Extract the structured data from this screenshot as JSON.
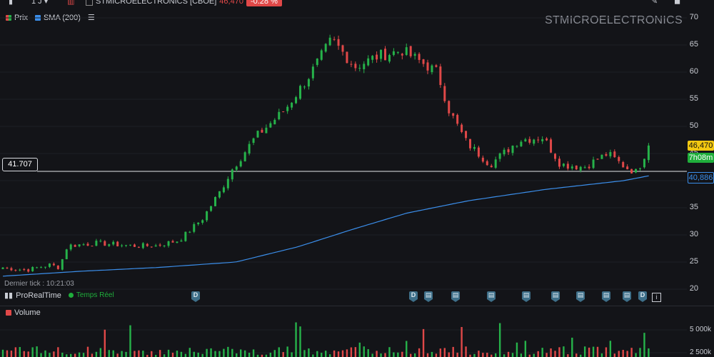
{
  "toolbar": {
    "interval": "1 J",
    "symbol_label": "STMICROELECTRONICS [CBOE]",
    "last_price": "46,470",
    "change": "-0.28 %"
  },
  "legend": {
    "price_label": "Prix",
    "sma_label": "SMA (200)",
    "price_color": "#26a69a",
    "sma_color": "#3b8eea"
  },
  "watermark": "STMICROELECTRONICS",
  "horizontal_line": {
    "label": "41.707"
  },
  "price_tags": {
    "last": "46,470",
    "countdown": "7h08m",
    "sma": "40,886"
  },
  "status": {
    "last_tick": "Dernier tick : 10:21:03",
    "provider": "ProRealTime",
    "mode": "Temps Réel"
  },
  "event_markers": [
    {
      "icon": "dividend-icon",
      "text": "D"
    },
    {
      "icon": "dividend-icon",
      "text": "D"
    },
    {
      "icon": "report-icon",
      "text": ""
    },
    {
      "icon": "report-icon",
      "text": ""
    },
    {
      "icon": "report-icon",
      "text": ""
    },
    {
      "icon": "report-icon",
      "text": ""
    },
    {
      "icon": "report-icon",
      "text": ""
    },
    {
      "icon": "report-icon",
      "text": ""
    },
    {
      "icon": "report-icon",
      "text": ""
    },
    {
      "icon": "dividend-icon",
      "text": "D"
    }
  ],
  "volume": {
    "label": "Volume",
    "yticks": [
      "5 000k",
      "2 500k"
    ]
  },
  "colors": {
    "up": "#26b24a",
    "down": "#e04848",
    "background": "#131418"
  },
  "chart_data": {
    "type": "candlestick",
    "yticks": [
      70,
      65,
      60,
      55,
      50,
      45,
      40,
      35,
      30,
      25,
      20
    ],
    "ylim": [
      19,
      71.5
    ],
    "horizontal_line_value": 41.707,
    "last_price": 46.47,
    "sma_last": 40.886,
    "close_anchors": [
      [
        0,
        24
      ],
      [
        20,
        23.5
      ],
      [
        40,
        24.5
      ],
      [
        48,
        24
      ],
      [
        55,
        28
      ],
      [
        80,
        28.5
      ],
      [
        110,
        28
      ],
      [
        130,
        28
      ],
      [
        150,
        29
      ],
      [
        170,
        33
      ],
      [
        185,
        38
      ],
      [
        195,
        42
      ],
      [
        215,
        48
      ],
      [
        240,
        53
      ],
      [
        260,
        59
      ],
      [
        280,
        66
      ],
      [
        300,
        61
      ],
      [
        320,
        63
      ],
      [
        340,
        64
      ],
      [
        370,
        60
      ],
      [
        380,
        53
      ],
      [
        395,
        47
      ],
      [
        415,
        43
      ],
      [
        440,
        47.5
      ],
      [
        460,
        48
      ],
      [
        475,
        43
      ],
      [
        495,
        42.5
      ],
      [
        515,
        45
      ],
      [
        530,
        42.5
      ],
      [
        540,
        41.5
      ],
      [
        550,
        46.5
      ]
    ],
    "sma_anchors": [
      [
        0,
        22.4
      ],
      [
        100,
        23.3
      ],
      [
        200,
        24.0
      ],
      [
        300,
        25.0
      ],
      [
        380,
        27.8
      ],
      [
        450,
        31.0
      ],
      [
        520,
        34.0
      ],
      [
        600,
        36.3
      ],
      [
        700,
        38.4
      ],
      [
        800,
        40.0
      ],
      [
        832,
        40.886
      ]
    ]
  }
}
